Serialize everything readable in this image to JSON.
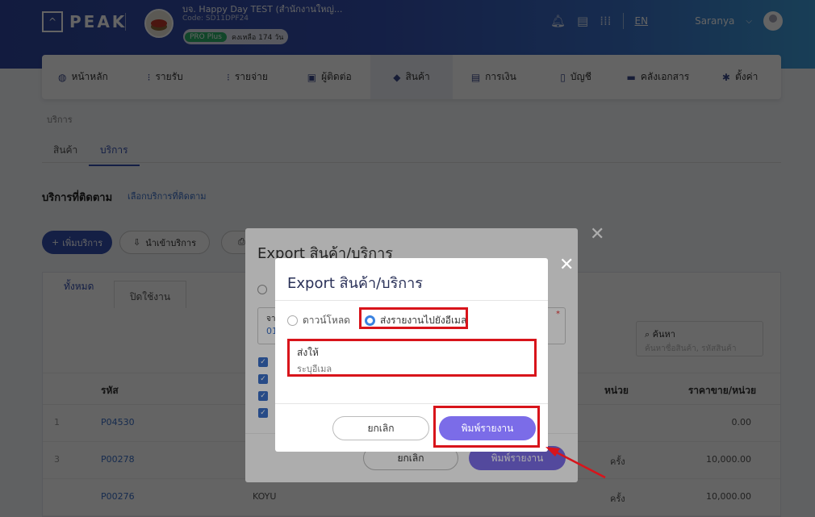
{
  "header": {
    "logo": "PEAK",
    "company_name": "บจ. Happy Day TEST (สำนักงานใหญ่...",
    "company_code": "Code: SD11DPF24",
    "plan_badge": "PRO Plus",
    "plan_remaining": "คงเหลือ 174 วัน",
    "language": "EN",
    "username": "Saranya",
    "icons": [
      "bell-icon",
      "document-icon",
      "apps-grid-icon"
    ]
  },
  "nav": {
    "items": [
      {
        "label": "หน้าหลัก",
        "icon": "gauge-icon",
        "glyph": "◍"
      },
      {
        "label": "รายรับ",
        "icon": "income-icon",
        "glyph": "⁝"
      },
      {
        "label": "รายจ่าย",
        "icon": "expense-icon",
        "glyph": "⁝"
      },
      {
        "label": "ผู้ติดต่อ",
        "icon": "contacts-icon",
        "glyph": "▣"
      },
      {
        "label": "สินค้า",
        "icon": "cube-icon",
        "glyph": "◆"
      },
      {
        "label": "การเงิน",
        "icon": "money-icon",
        "glyph": "▤"
      },
      {
        "label": "บัญชี",
        "icon": "book-icon",
        "glyph": "▯"
      },
      {
        "label": "คลังเอกสาร",
        "icon": "folder-icon",
        "glyph": "▬"
      },
      {
        "label": "ตั้งค่า",
        "icon": "gear-icon",
        "glyph": "✱"
      }
    ],
    "active": "สินค้า"
  },
  "page": {
    "breadcrumb": "บริการ",
    "tabs": {
      "products": "สินค้า",
      "services": "บริการ"
    },
    "section_title": "บริการที่ติดตาม",
    "section_link": "เลือกบริการที่ติดตาม",
    "add_button": "เพิ่มบริการ",
    "import_button": "นำเข้าบริการ"
  },
  "list": {
    "tab_all": "ทั้งหมด",
    "tab_closed": "ปิดใช้งาน",
    "search_label": "ค้นหา",
    "search_placeholder": "ค้นหาชื่อสินค้า, รหัสสินค้า",
    "columns": {
      "code": "รหัส",
      "unit": "หน่วย",
      "price": "ราคาขาย/หน่วย"
    },
    "rows": [
      {
        "idx": "1",
        "code": "P04530",
        "name": "",
        "unit": "",
        "price": "0.00"
      },
      {
        "idx": "3",
        "code": "P00278",
        "name": "",
        "unit": "ครั้ง",
        "price": "10,000.00"
      },
      {
        "idx": "",
        "code": "P00276",
        "name": "KOYU",
        "unit": "ครั้ง",
        "price": "10,000.00"
      }
    ]
  },
  "modal_back": {
    "title": "Export สินค้า/บริการ",
    "date_label": "จา",
    "date_value": "01",
    "required_mark": "*",
    "cancel": "ยกเลิก",
    "print": "พิมพ์รายงาน"
  },
  "modal_front": {
    "title": "Export สินค้า/บริการ",
    "option_download": "ดาวน์โหลด",
    "option_email": "ส่งรายงานไปยังอีเมล",
    "selected_option": "email",
    "send_to_label": "ส่งให้",
    "email_placeholder": "ระบุอีเมล",
    "cancel": "ยกเลิก",
    "print": "พิมพ์รายงาน"
  },
  "colors": {
    "primary": "#3550b0",
    "accent_button": "#7b6ce8",
    "highlight": "#d8141b",
    "link": "#3a6fc8"
  }
}
